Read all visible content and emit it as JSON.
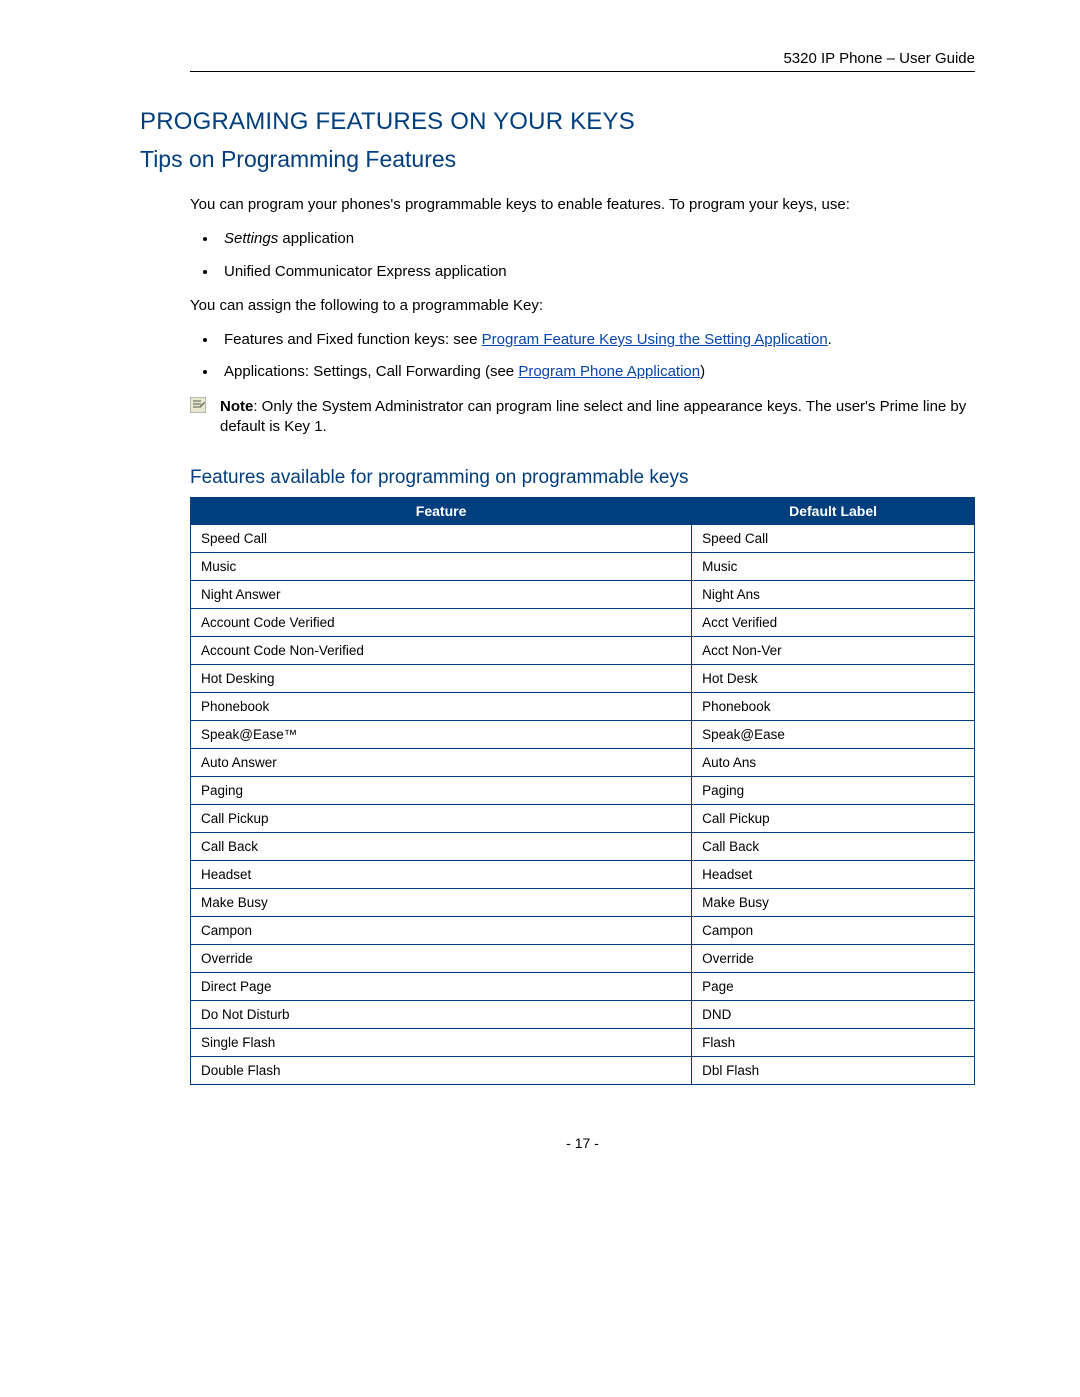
{
  "header": {
    "right": "5320 IP Phone – User Guide"
  },
  "h1": "PROGRAMING FEATURES ON YOUR KEYS",
  "h2": "Tips on Programming Features",
  "intro": "You can program your phones's programmable keys to enable features. To program your keys, use:",
  "bullets1": {
    "item1_pre": "Settings",
    "item1_post": " application",
    "item2": "Unified Communicator Express application"
  },
  "assign": "You can assign the following to a programmable Key:",
  "bullets2": {
    "item1_pre": "Features and Fixed function keys: see ",
    "item1_link": "Program Feature Keys Using the Setting Application",
    "item1_post": ".",
    "item2_pre": "Applications: Settings, Call Forwarding (see ",
    "item2_link": "Program Phone Application",
    "item2_post": ")"
  },
  "note": {
    "label": "Note",
    "text": ": Only the System Administrator can program line select and line appearance keys. The user's Prime line by default is Key 1."
  },
  "h3": "Features available for programming on programmable keys",
  "table": {
    "head1": "Feature",
    "head2": "Default Label",
    "rows": [
      {
        "f": "Speed Call",
        "d": "Speed Call"
      },
      {
        "f": "Music",
        "d": "Music"
      },
      {
        "f": "Night Answer",
        "d": "Night Ans"
      },
      {
        "f": "Account Code Verified",
        "d": "Acct Verified"
      },
      {
        "f": "Account Code Non-Verified",
        "d": "Acct Non-Ver"
      },
      {
        "f": "Hot Desking",
        "d": "Hot Desk"
      },
      {
        "f": "Phonebook",
        "d": "Phonebook"
      },
      {
        "f": "Speak@Ease™",
        "d": "Speak@Ease"
      },
      {
        "f": "Auto Answer",
        "d": "Auto Ans"
      },
      {
        "f": "Paging",
        "d": "Paging"
      },
      {
        "f": "Call Pickup",
        "d": "Call Pickup"
      },
      {
        "f": "Call Back",
        "d": "Call Back"
      },
      {
        "f": "Headset",
        "d": "Headset"
      },
      {
        "f": "Make Busy",
        "d": "Make Busy"
      },
      {
        "f": "Campon",
        "d": "Campon"
      },
      {
        "f": "Override",
        "d": "Override"
      },
      {
        "f": "Direct Page",
        "d": "Page"
      },
      {
        "f": "Do Not Disturb",
        "d": "DND"
      },
      {
        "f": "Single Flash",
        "d": "Flash"
      },
      {
        "f": "Double Flash",
        "d": "Dbl Flash"
      }
    ]
  },
  "footer": "- 17 -"
}
